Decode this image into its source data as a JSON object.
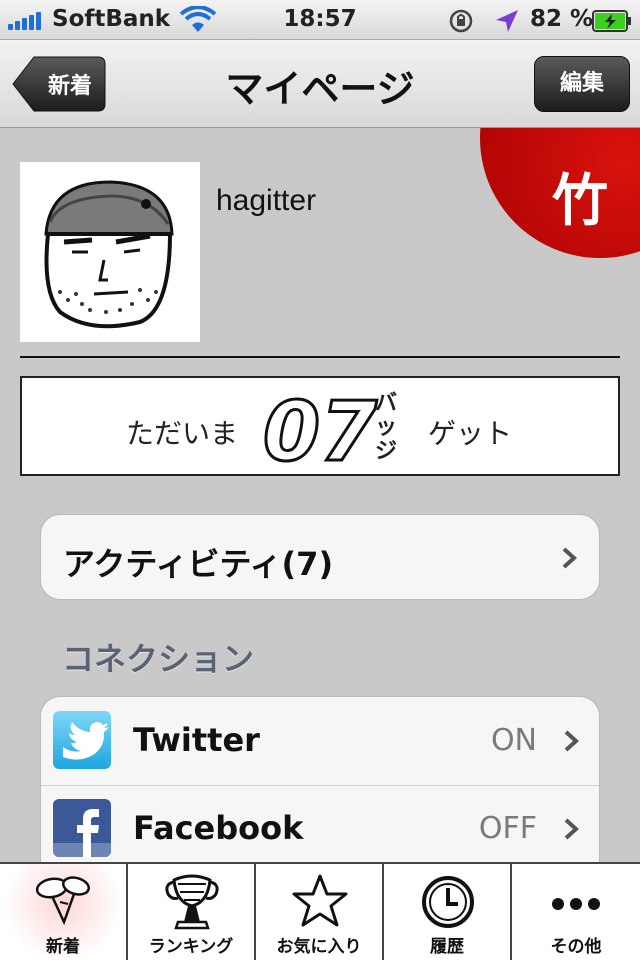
{
  "status_bar": {
    "carrier": "SoftBank",
    "time": "18:57",
    "battery_percent": "82 %"
  },
  "nav": {
    "back_label": "新着",
    "title": "マイページ",
    "edit_label": "編集"
  },
  "rank_badge": "竹",
  "profile": {
    "username": "hagitter"
  },
  "badges": {
    "prefix": "ただいま",
    "count": "07",
    "unit_vertical": "バッジ",
    "suffix": "ゲット"
  },
  "activity": {
    "label": "アクティビティ(7)"
  },
  "connections": {
    "header": "コネクション",
    "items": [
      {
        "name": "Twitter",
        "status": "ON",
        "icon": "twitter-icon"
      },
      {
        "name": "Facebook",
        "status": "OFF",
        "icon": "facebook-icon"
      }
    ]
  },
  "tabs": [
    {
      "label": "新着",
      "icon": "balloons-icon",
      "active": true
    },
    {
      "label": "ランキング",
      "icon": "trophy-icon",
      "active": false
    },
    {
      "label": "お気に入り",
      "icon": "star-icon",
      "active": false
    },
    {
      "label": "履歴",
      "icon": "clock-icon",
      "active": false
    },
    {
      "label": "その他",
      "icon": "more-icon",
      "active": false
    }
  ],
  "colors": {
    "accent_red": "#c00000",
    "twitter_blue": "#2fb4ea",
    "facebook_blue": "#3b5998",
    "ios_blue": "#1e6fd8"
  }
}
